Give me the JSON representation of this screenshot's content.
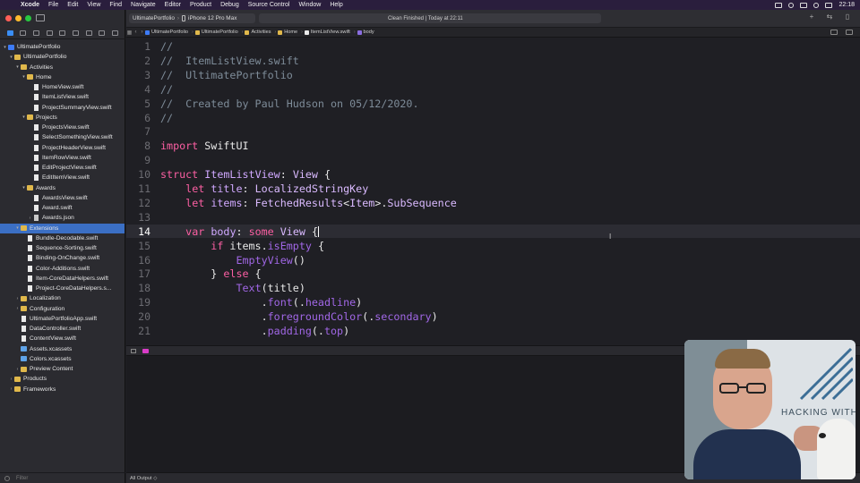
{
  "menubar": {
    "apple_icon": "apple-icon",
    "app_name": "Xcode",
    "menus": [
      "File",
      "Edit",
      "View",
      "Find",
      "Navigate",
      "Editor",
      "Product",
      "Debug",
      "Source Control",
      "Window",
      "Help"
    ],
    "clock": "22:18"
  },
  "toolbar": {
    "scheme_project": "UltimatePortfolio",
    "scheme_device": "iPhone 12 Pro Max",
    "activity_status": "Clean Finished | Today at 22:11"
  },
  "jumpbar": {
    "crumbs": [
      "UltimatePortfolio",
      "UltimatePortfolio",
      "Activities",
      "Home",
      "ItemListView.swift",
      "body"
    ]
  },
  "navigator": {
    "filter_placeholder": "Filter",
    "items": [
      {
        "label": "UltimatePortfolio",
        "kind": "project",
        "chev": "▾"
      },
      {
        "label": "UltimatePortfolio",
        "kind": "folder",
        "chev": "▾"
      },
      {
        "label": "Activities",
        "kind": "folder",
        "chev": "▾"
      },
      {
        "label": "Home",
        "kind": "folder",
        "chev": "▾"
      },
      {
        "label": "HomeView.swift",
        "kind": "swift",
        "chev": ""
      },
      {
        "label": "ItemListView.swift",
        "kind": "swift",
        "chev": ""
      },
      {
        "label": "ProjectSummaryView.swift",
        "kind": "swift",
        "chev": ""
      },
      {
        "label": "Projects",
        "kind": "folder",
        "chev": "▾"
      },
      {
        "label": "ProjectsView.swift",
        "kind": "swift",
        "chev": ""
      },
      {
        "label": "SelectSomethingView.swift",
        "kind": "swift",
        "chev": ""
      },
      {
        "label": "ProjectHeaderView.swift",
        "kind": "swift",
        "chev": ""
      },
      {
        "label": "ItemRowView.swift",
        "kind": "swift",
        "chev": ""
      },
      {
        "label": "EditProjectView.swift",
        "kind": "swift",
        "chev": ""
      },
      {
        "label": "EditItemView.swift",
        "kind": "swift",
        "chev": ""
      },
      {
        "label": "Awards",
        "kind": "folder",
        "chev": "▾"
      },
      {
        "label": "AwardsView.swift",
        "kind": "swift",
        "chev": ""
      },
      {
        "label": "Award.swift",
        "kind": "swift",
        "chev": ""
      },
      {
        "label": "Awards.json",
        "kind": "json",
        "chev": "›"
      },
      {
        "label": "Extensions",
        "kind": "folder",
        "chev": "▾",
        "selected": true
      },
      {
        "label": "Bundle-Decodable.swift",
        "kind": "swift",
        "chev": ""
      },
      {
        "label": "Sequence-Sorting.swift",
        "kind": "swift",
        "chev": ""
      },
      {
        "label": "Binding-OnChange.swift",
        "kind": "swift",
        "chev": ""
      },
      {
        "label": "Color-Additions.swift",
        "kind": "swift",
        "chev": ""
      },
      {
        "label": "Item-CoreDataHelpers.swift",
        "kind": "swift",
        "chev": ""
      },
      {
        "label": "Project-CoreDataHelpers.s...",
        "kind": "swift",
        "chev": ""
      },
      {
        "label": "Localization",
        "kind": "folder",
        "chev": "›"
      },
      {
        "label": "Configuration",
        "kind": "folder",
        "chev": "›"
      },
      {
        "label": "UltimatePortfolioApp.swift",
        "kind": "swift",
        "chev": ""
      },
      {
        "label": "DataController.swift",
        "kind": "swift",
        "chev": ""
      },
      {
        "label": "ContentView.swift",
        "kind": "swift",
        "chev": ""
      },
      {
        "label": "Assets.xcassets",
        "kind": "assets",
        "chev": ""
      },
      {
        "label": "Colors.xcassets",
        "kind": "assets",
        "chev": ""
      },
      {
        "label": "Preview Content",
        "kind": "folder",
        "chev": "›"
      },
      {
        "label": "Products",
        "kind": "folder",
        "chev": "›"
      },
      {
        "label": "Frameworks",
        "kind": "folder",
        "chev": "›"
      }
    ],
    "indent_levels": [
      0,
      1,
      2,
      3,
      4,
      4,
      4,
      3,
      4,
      4,
      4,
      4,
      4,
      4,
      3,
      4,
      4,
      4,
      2,
      3,
      3,
      3,
      3,
      3,
      3,
      2,
      2,
      2,
      2,
      2,
      2,
      2,
      2,
      1,
      1
    ]
  },
  "editor": {
    "current_line": 14,
    "lines": [
      {
        "n": "1",
        "tokens": [
          [
            "comment",
            "//"
          ]
        ]
      },
      {
        "n": "2",
        "tokens": [
          [
            "comment",
            "//  ItemListView.swift"
          ]
        ]
      },
      {
        "n": "3",
        "tokens": [
          [
            "comment",
            "//  UltimatePortfolio"
          ]
        ]
      },
      {
        "n": "4",
        "tokens": [
          [
            "comment",
            "//"
          ]
        ]
      },
      {
        "n": "5",
        "tokens": [
          [
            "comment",
            "//  Created by Paul Hudson on 05/12/2020."
          ]
        ]
      },
      {
        "n": "6",
        "tokens": [
          [
            "comment",
            "//"
          ]
        ]
      },
      {
        "n": "7",
        "tokens": []
      },
      {
        "n": "8",
        "tokens": [
          [
            "kw",
            "import"
          ],
          [
            "plain",
            " SwiftUI"
          ]
        ]
      },
      {
        "n": "9",
        "tokens": []
      },
      {
        "n": "10",
        "tokens": [
          [
            "kw",
            "struct"
          ],
          [
            "plain",
            " "
          ],
          [
            "type",
            "ItemListView"
          ],
          [
            "plain",
            ": "
          ],
          [
            "type2",
            "View"
          ],
          [
            "plain",
            " {"
          ]
        ]
      },
      {
        "n": "11",
        "tokens": [
          [
            "plain",
            "    "
          ],
          [
            "kw",
            "let"
          ],
          [
            "plain",
            " "
          ],
          [
            "type",
            "title"
          ],
          [
            "plain",
            ": "
          ],
          [
            "type2",
            "LocalizedStringKey"
          ]
        ]
      },
      {
        "n": "12",
        "tokens": [
          [
            "plain",
            "    "
          ],
          [
            "kw",
            "let"
          ],
          [
            "plain",
            " "
          ],
          [
            "type",
            "items"
          ],
          [
            "plain",
            ": "
          ],
          [
            "type2",
            "FetchedResults"
          ],
          [
            "plain",
            "<"
          ],
          [
            "type2",
            "Item"
          ],
          [
            "plain",
            ">."
          ],
          [
            "type2",
            "SubSequence"
          ]
        ]
      },
      {
        "n": "13",
        "tokens": []
      },
      {
        "n": "14",
        "tokens": [
          [
            "plain",
            "    "
          ],
          [
            "kw",
            "var"
          ],
          [
            "plain",
            " "
          ],
          [
            "type",
            "body"
          ],
          [
            "plain",
            ": "
          ],
          [
            "kw",
            "some"
          ],
          [
            "plain",
            " "
          ],
          [
            "type2",
            "View"
          ],
          [
            "plain",
            " {"
          ]
        ],
        "caret": true
      },
      {
        "n": "15",
        "tokens": [
          [
            "plain",
            "        "
          ],
          [
            "kw",
            "if"
          ],
          [
            "plain",
            " items."
          ],
          [
            "member",
            "isEmpty"
          ],
          [
            "plain",
            " {"
          ]
        ]
      },
      {
        "n": "16",
        "tokens": [
          [
            "plain",
            "            "
          ],
          [
            "func",
            "EmptyView"
          ],
          [
            "plain",
            "()"
          ]
        ]
      },
      {
        "n": "17",
        "tokens": [
          [
            "plain",
            "        } "
          ],
          [
            "kw",
            "else"
          ],
          [
            "plain",
            " {"
          ]
        ]
      },
      {
        "n": "18",
        "tokens": [
          [
            "plain",
            "            "
          ],
          [
            "func",
            "Text"
          ],
          [
            "plain",
            "(title)"
          ]
        ]
      },
      {
        "n": "19",
        "tokens": [
          [
            "plain",
            "                ."
          ],
          [
            "member",
            "font"
          ],
          [
            "plain",
            "(."
          ],
          [
            "member",
            "headline"
          ],
          [
            "plain",
            ")"
          ]
        ]
      },
      {
        "n": "20",
        "tokens": [
          [
            "plain",
            "                ."
          ],
          [
            "member",
            "foregroundColor"
          ],
          [
            "plain",
            "(."
          ],
          [
            "member",
            "secondary"
          ],
          [
            "plain",
            ")"
          ]
        ]
      },
      {
        "n": "21",
        "tokens": [
          [
            "plain",
            "                ."
          ],
          [
            "member",
            "padding"
          ],
          [
            "plain",
            "(."
          ],
          [
            "member",
            "top"
          ],
          [
            "plain",
            ")"
          ]
        ]
      }
    ]
  },
  "console": {
    "output_selector": "All Output ◇"
  },
  "webcam": {
    "banner_text": "HACKING WITH"
  },
  "colors": {
    "selection": "#3b6fc4",
    "keyword": "#fc5fa3",
    "comment": "#7e8c99",
    "type": "#d0a8ff"
  }
}
